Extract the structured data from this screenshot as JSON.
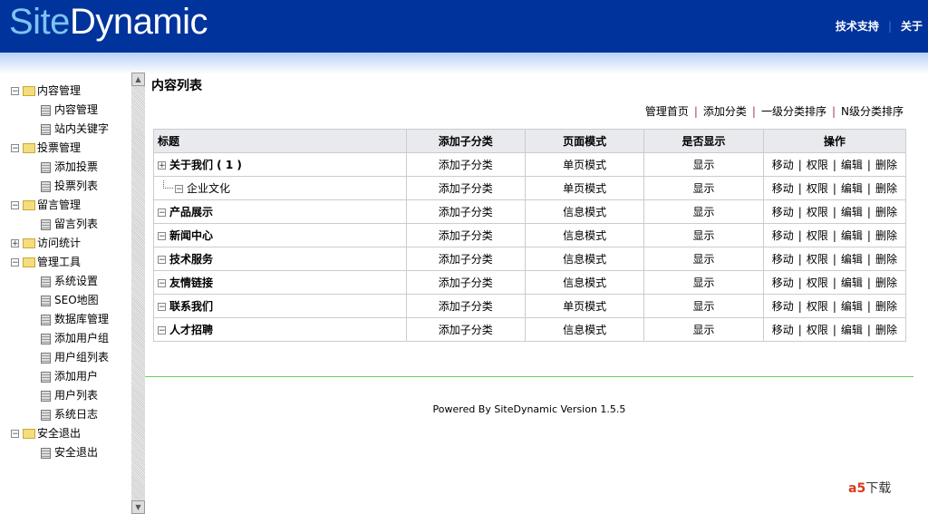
{
  "header": {
    "logo_a": "Site",
    "logo_b": "Dynamic",
    "links": [
      "技术支持",
      "关于"
    ]
  },
  "sidebar": [
    {
      "label": "内容管理",
      "open": true,
      "children": [
        "内容管理",
        "站内关键字"
      ]
    },
    {
      "label": "投票管理",
      "open": true,
      "children": [
        "添加投票",
        "投票列表"
      ]
    },
    {
      "label": "留言管理",
      "open": true,
      "children": [
        "留言列表"
      ]
    },
    {
      "label": "访问统计",
      "open": false,
      "children": []
    },
    {
      "label": "管理工具",
      "open": true,
      "children": [
        "系统设置",
        "SEO地图",
        "数据库管理",
        "添加用户组",
        "用户组列表",
        "添加用户",
        "用户列表",
        "系统日志"
      ]
    },
    {
      "label": "安全退出",
      "open": true,
      "children": [
        "安全退出"
      ]
    }
  ],
  "main": {
    "title": "内容列表",
    "ops": [
      "管理首页",
      "添加分类",
      "一级分类排序",
      "N级分类排序"
    ],
    "columns": [
      "标题",
      "添加子分类",
      "页面模式",
      "是否显示",
      "操作"
    ],
    "rows": [
      {
        "title": "关于我们 ( 1 )",
        "sub": false,
        "expand": "+",
        "add": "添加子分类",
        "mode": "单页模式",
        "show": "显示"
      },
      {
        "title": "企业文化",
        "sub": true,
        "expand": "-",
        "add": "添加子分类",
        "mode": "单页模式",
        "show": "显示"
      },
      {
        "title": "产品展示",
        "sub": false,
        "expand": "-",
        "add": "添加子分类",
        "mode": "信息模式",
        "show": "显示"
      },
      {
        "title": "新闻中心",
        "sub": false,
        "expand": "-",
        "add": "添加子分类",
        "mode": "信息模式",
        "show": "显示"
      },
      {
        "title": "技术服务",
        "sub": false,
        "expand": "-",
        "add": "添加子分类",
        "mode": "信息模式",
        "show": "显示"
      },
      {
        "title": "友情链接",
        "sub": false,
        "expand": "-",
        "add": "添加子分类",
        "mode": "信息模式",
        "show": "显示"
      },
      {
        "title": "联系我们",
        "sub": false,
        "expand": "-",
        "add": "添加子分类",
        "mode": "单页模式",
        "show": "显示"
      },
      {
        "title": "人才招聘",
        "sub": false,
        "expand": "-",
        "add": "添加子分类",
        "mode": "信息模式",
        "show": "显示"
      }
    ],
    "actions": [
      "移动",
      "权限",
      "编辑",
      "删除"
    ]
  },
  "footer": "Powered By SiteDynamic Version 1.5.5",
  "watermark": {
    "brand": "a5",
    "text": "下载",
    "url": "xiazai.com"
  }
}
